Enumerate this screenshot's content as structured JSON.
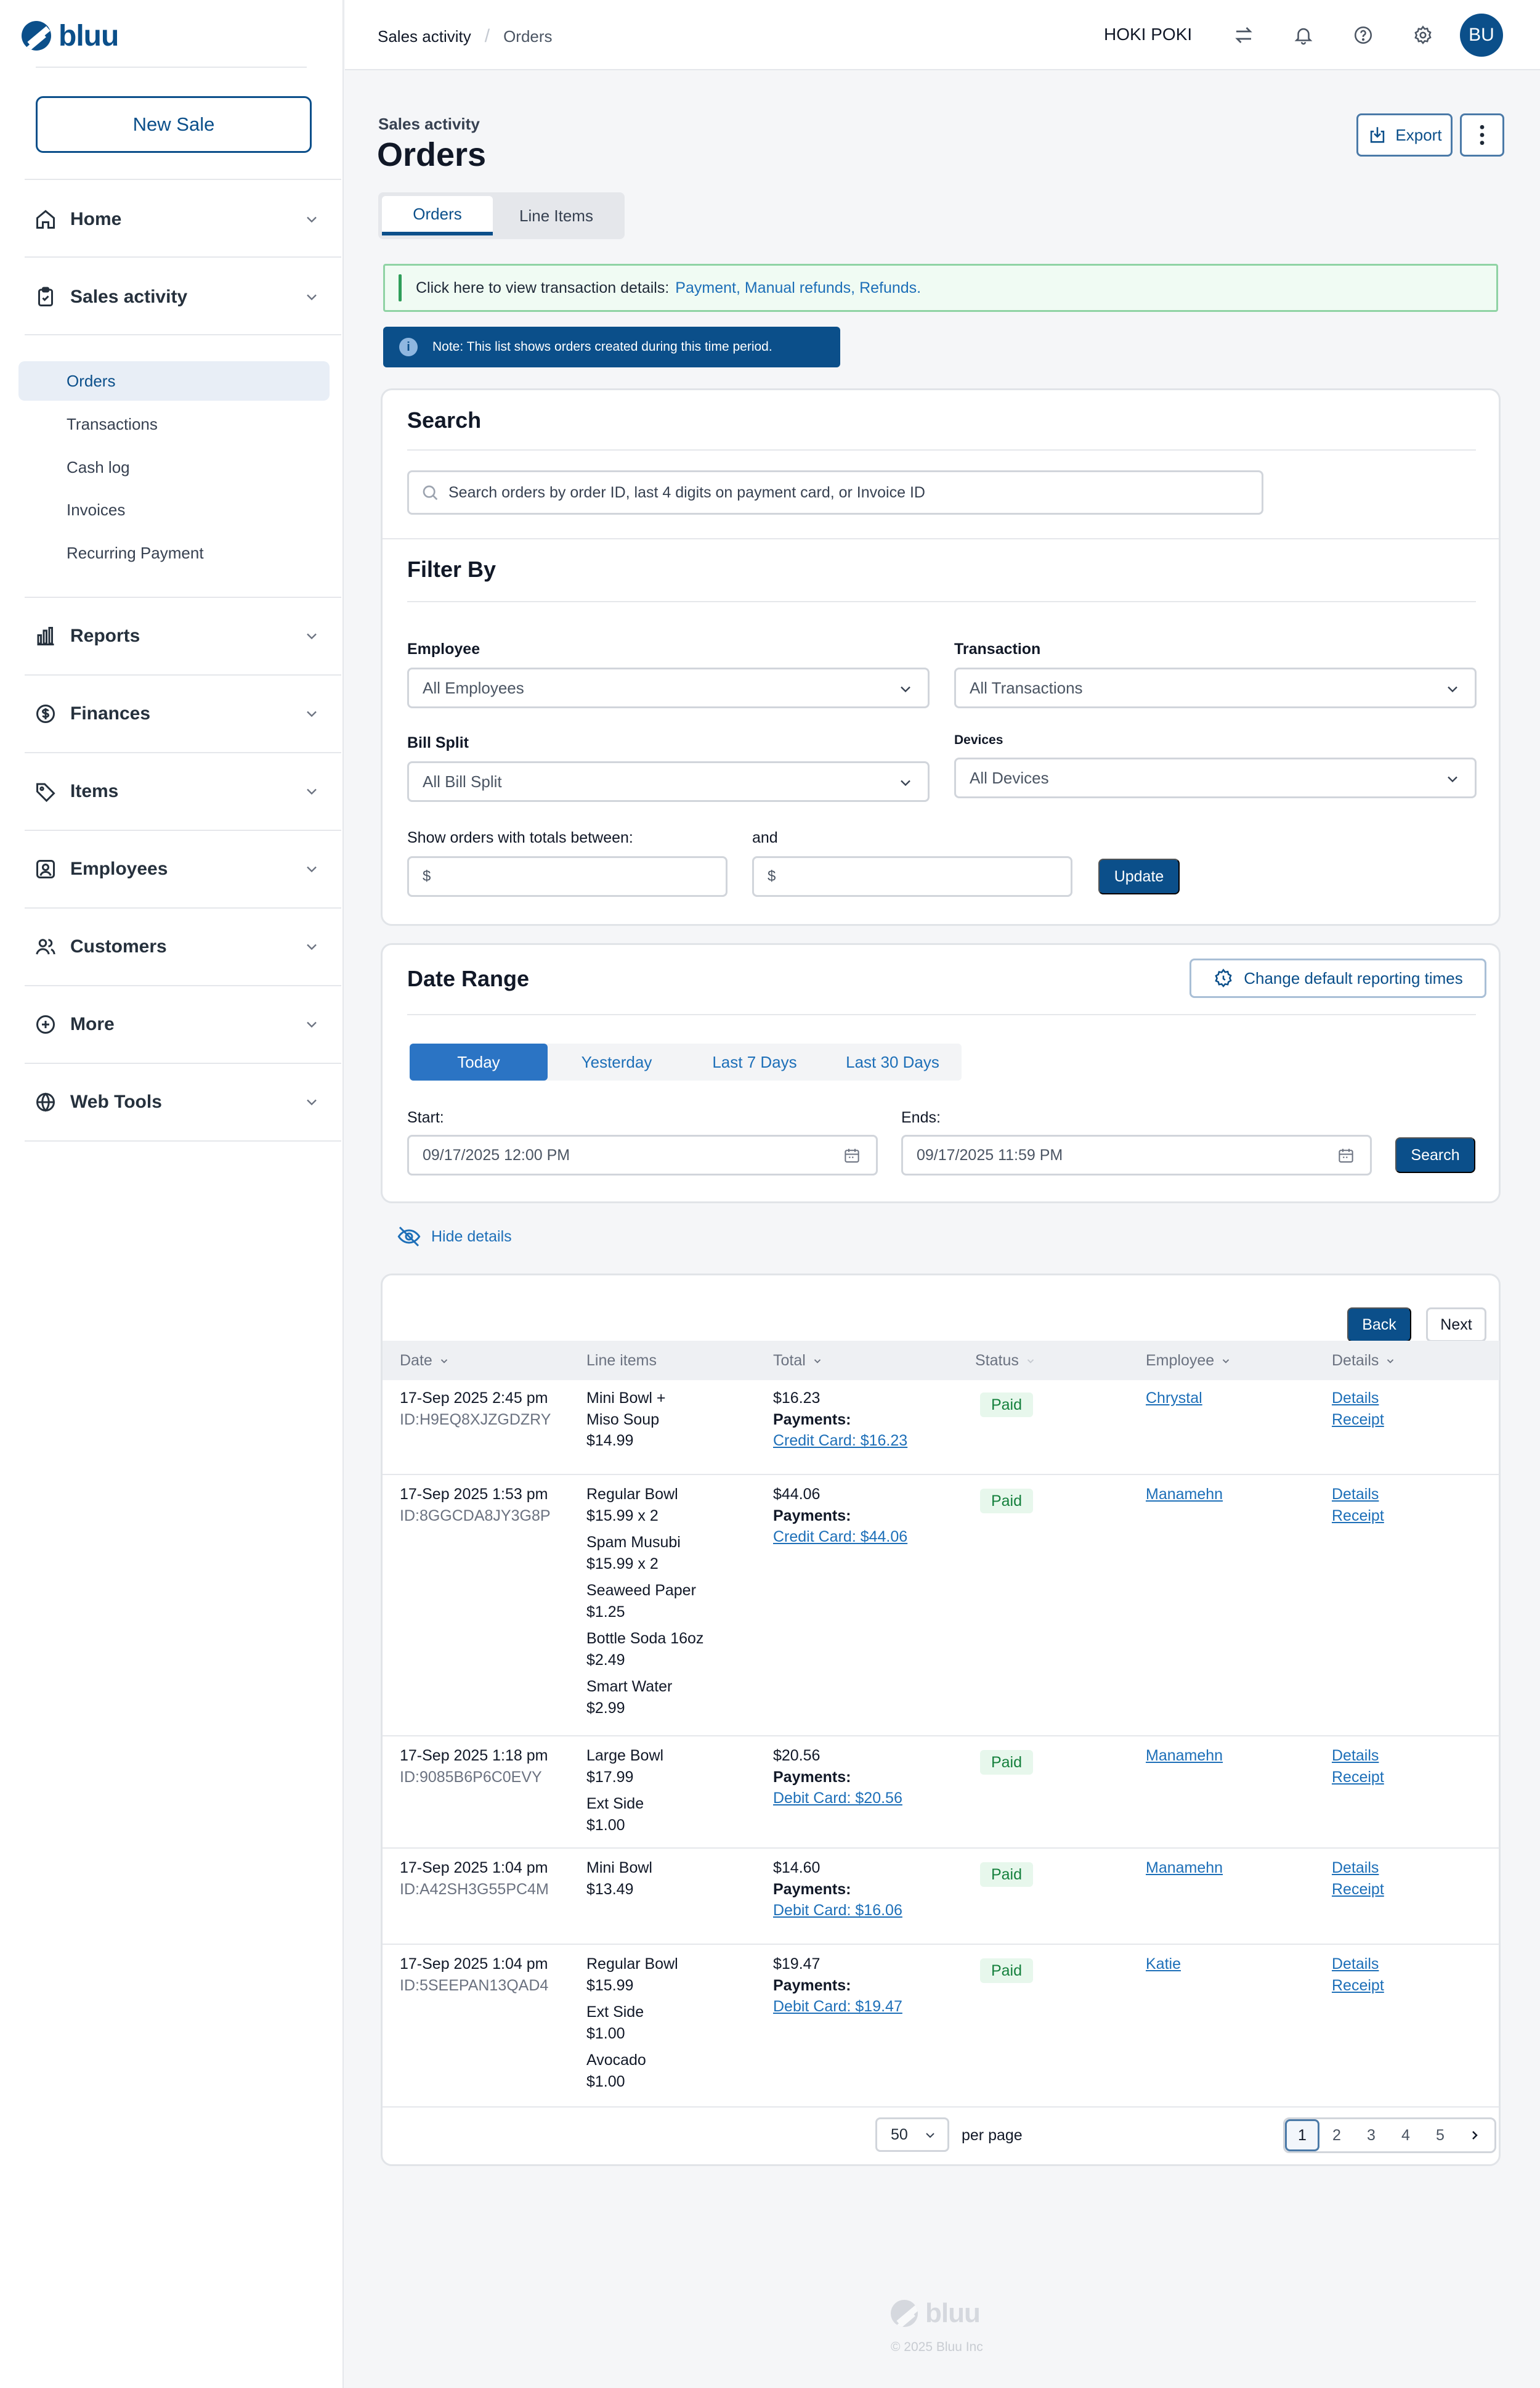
{
  "app": {
    "logo_text": "bluu"
  },
  "sidebar": {
    "new_sale_label": "New Sale",
    "items": [
      {
        "label": "Home",
        "icon": "home-icon"
      },
      {
        "label": "Sales activity",
        "icon": "clipboard-icon"
      },
      {
        "label": "Reports",
        "icon": "bar-chart-icon"
      },
      {
        "label": "Finances",
        "icon": "dollar-circle-icon"
      },
      {
        "label": "Items",
        "icon": "tag-icon"
      },
      {
        "label": "Employees",
        "icon": "employee-badge-icon"
      },
      {
        "label": "Customers",
        "icon": "users-icon"
      },
      {
        "label": "More",
        "icon": "plus-circle-icon"
      },
      {
        "label": "Web Tools",
        "icon": "globe-icon"
      }
    ],
    "sales_sub": [
      "Orders",
      "Transactions",
      "Cash log",
      "Invoices",
      "Recurring Payment"
    ]
  },
  "topbar": {
    "breadcrumb": [
      "Sales activity",
      "Orders"
    ],
    "store_name": "HOKI POKI",
    "avatar_initials": "BU"
  },
  "page": {
    "eyebrow": "Sales activity",
    "title": "Orders",
    "export_label": "Export",
    "tabs": [
      "Orders",
      "Line Items"
    ],
    "alert_text": "Click here to view transaction details:",
    "alert_links": "Payment, Manual refunds, Refunds.",
    "note_text": "Note: This list shows orders created during this time period."
  },
  "search": {
    "title": "Search",
    "placeholder": "Search orders by order ID, last 4 digits on payment card, or Invoice ID"
  },
  "filter": {
    "title": "Filter By",
    "employee_label": "Employee",
    "employee_value": "All Employees",
    "transaction_label": "Transaction",
    "transaction_value": "All Transactions",
    "bill_split_label": "Bill Split",
    "bill_split_value": "All Bill Split",
    "devices_label": "Devices",
    "devices_value": "All Devices",
    "totals_label": "Show orders with totals between:",
    "and_label": "and",
    "min_prefix": "$",
    "max_prefix": "$",
    "update_label": "Update"
  },
  "date_range": {
    "title": "Date Range",
    "change_times_label": "Change default reporting times",
    "presets": [
      "Today",
      "Yesterday",
      "Last 7 Days",
      "Last 30 Days"
    ],
    "start_label": "Start:",
    "start_value": "09/17/2025 12:00 PM",
    "end_label": "Ends:",
    "end_value": "09/17/2025 11:59 PM",
    "search_label": "Search"
  },
  "hide_details_label": "Hide details",
  "table": {
    "back_label": "Back",
    "next_label": "Next",
    "headers": [
      "Date",
      "Line items",
      "Total",
      "Status",
      "Employee",
      "Details"
    ],
    "rows": [
      {
        "date": "17-Sep 2025 2:45 pm",
        "id": "ID:H9EQ8XJZGDZRY",
        "items": [
          "Mini Bowl +",
          "Miso Soup",
          "$14.99"
        ],
        "total": "$16.23",
        "payments_label": "Payments:",
        "payment": "Credit Card: $16.23",
        "status": "Paid",
        "employee": "Chrystal",
        "details": "Details",
        "receipt": "Receipt"
      },
      {
        "date": "17-Sep 2025 1:53 pm",
        "id": "ID:8GGCDA8JY3G8P",
        "items": [
          "Regular Bowl",
          "$15.99 x 2",
          "Spam Musubi",
          "$15.99 x 2",
          "Seaweed Paper",
          "$1.25",
          "Bottle Soda 16oz",
          "$2.49",
          "Smart Water",
          "$2.99"
        ],
        "total": "$44.06",
        "payments_label": "Payments:",
        "payment": "Credit Card: $44.06",
        "status": "Paid",
        "employee": "Manamehn",
        "details": "Details",
        "receipt": "Receipt"
      },
      {
        "date": "17-Sep 2025 1:18 pm",
        "id": "ID:9085B6P6C0EVY",
        "items": [
          "Large Bowl",
          "$17.99",
          "Ext Side",
          "$1.00"
        ],
        "total": "$20.56",
        "payments_label": "Payments:",
        "payment": "Debit Card: $20.56",
        "status": "Paid",
        "employee": "Manamehn",
        "details": "Details",
        "receipt": "Receipt"
      },
      {
        "date": "17-Sep 2025 1:04 pm",
        "id": "ID:A42SH3G55PC4M",
        "items": [
          "Mini Bowl",
          "$13.49"
        ],
        "total": "$14.60",
        "payments_label": "Payments:",
        "payment": "Debit Card: $16.06",
        "status": "Paid",
        "employee": "Manamehn",
        "details": "Details",
        "receipt": "Receipt"
      },
      {
        "date": "17-Sep 2025 1:04 pm",
        "id": "ID:5SEEPAN13QAD4",
        "items": [
          "Regular Bowl",
          "$15.99",
          "Ext Side",
          "$1.00",
          "Avocado",
          "$1.00"
        ],
        "total": "$19.47",
        "payments_label": "Payments:",
        "payment": "Debit Card: $19.47",
        "status": "Paid",
        "employee": "Katie",
        "details": "Details",
        "receipt": "Receipt"
      }
    ],
    "per_page_value": "50",
    "per_page_label": "per page",
    "pages": [
      "1",
      "2",
      "3",
      "4",
      "5"
    ]
  },
  "footer": {
    "logo_text": "bluu",
    "copyright": "© 2025 Bluu Inc"
  },
  "colors": {
    "brand": "#0b4f8a",
    "link": "#1d6fb8",
    "paid_bg": "#e7f7ec",
    "paid_text": "#15803d"
  }
}
